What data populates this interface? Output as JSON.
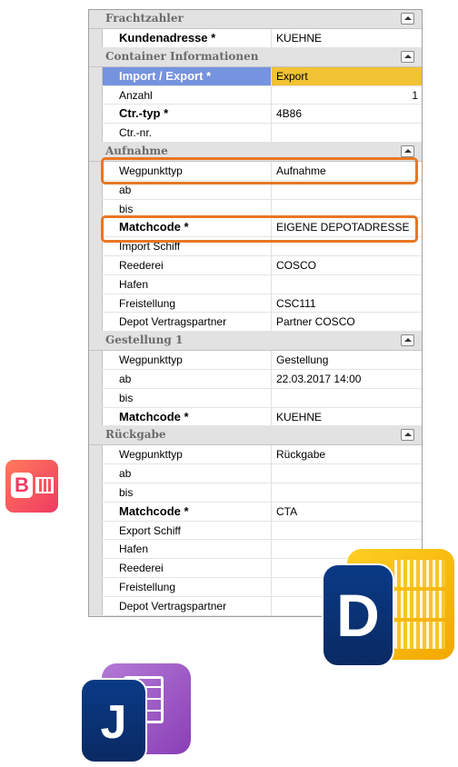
{
  "sections": [
    {
      "title": "Frachtzahler",
      "rows": [
        {
          "label": "Kundenadresse *",
          "value": "KUEHNE"
        }
      ]
    },
    {
      "title": "Container Informationen",
      "rows": [
        {
          "label": "Import / Export *",
          "value": "Export"
        },
        {
          "label": "Anzahl",
          "value": "1"
        },
        {
          "label": "Ctr.-typ *",
          "value": "4B86"
        },
        {
          "label": "Ctr.-nr.",
          "value": ""
        }
      ]
    },
    {
      "title": "Aufnahme",
      "rows": [
        {
          "label": "Wegpunkttyp",
          "value": "Aufnahme"
        },
        {
          "label": "ab",
          "value": ""
        },
        {
          "label": "bis",
          "value": ""
        },
        {
          "label": "Matchcode *",
          "value": "EIGENE DEPOTADRESSE"
        },
        {
          "label": "Import Schiff",
          "value": ""
        },
        {
          "label": "Reederei",
          "value": "COSCO"
        },
        {
          "label": "Hafen",
          "value": ""
        },
        {
          "label": "Freistellung",
          "value": "CSC111"
        },
        {
          "label": "Depot Vertragspartner",
          "value": "Partner COSCO"
        }
      ]
    },
    {
      "title": "Gestellung 1",
      "rows": [
        {
          "label": "Wegpunkttyp",
          "value": "Gestellung"
        },
        {
          "label": "ab",
          "value": "22.03.2017 14:00"
        },
        {
          "label": "bis",
          "value": ""
        },
        {
          "label": "Matchcode *",
          "value": "KUEHNE"
        }
      ]
    },
    {
      "title": "Rückgabe",
      "rows": [
        {
          "label": "Wegpunkttyp",
          "value": "Rückgabe"
        },
        {
          "label": "ab",
          "value": ""
        },
        {
          "label": "bis",
          "value": ""
        },
        {
          "label": "Matchcode *",
          "value": "CTA"
        },
        {
          "label": "Export Schiff",
          "value": ""
        },
        {
          "label": "Hafen",
          "value": ""
        },
        {
          "label": "Reederei",
          "value": ""
        },
        {
          "label": "Freistellung",
          "value": ""
        },
        {
          "label": "Depot Vertragspartner",
          "value": ""
        }
      ]
    }
  ],
  "app_icons": {
    "b": {
      "letter": "B",
      "name": "container-app-icon"
    },
    "d": {
      "letter": "D",
      "name": "depot-app-icon"
    },
    "j": {
      "letter": "J",
      "name": "job-app-icon"
    }
  },
  "colors": {
    "highlight": "#e87722",
    "selected_label": "#7593df",
    "selected_value": "#f1c232"
  }
}
